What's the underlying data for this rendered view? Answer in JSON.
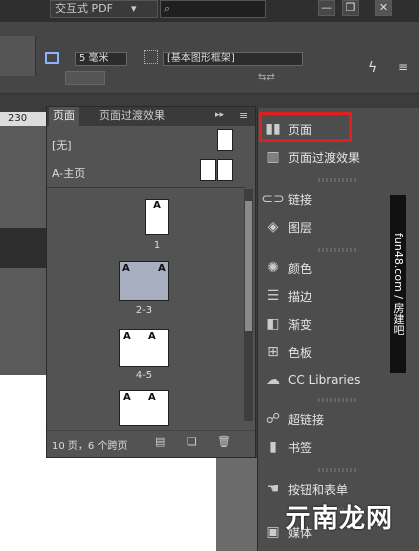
{
  "topbar": {
    "workspace": "交互式 PDF",
    "workspace_arrow": "▾",
    "search_icon": "⌕",
    "min": "—",
    "restore": "❐",
    "close": "✕"
  },
  "control": {
    "size_value": "5 毫米",
    "frame_style": "[基本图形框架]",
    "ruler_label": "230"
  },
  "pages_panel": {
    "tab_pages": "页面",
    "tab_transitions": "页面过渡效果",
    "master_none": "[无]",
    "master_a": "A-主页",
    "spreads": [
      {
        "label": "1",
        "pages": [
          "A"
        ]
      },
      {
        "label": "2-3",
        "pages": [
          "A",
          "A"
        ]
      },
      {
        "label": "4-5",
        "pages": [
          "A",
          "A"
        ]
      },
      {
        "label": "",
        "pages": [
          "A",
          "A"
        ]
      }
    ],
    "footer_text": "10 页，6 个跨页"
  },
  "dock": {
    "items": [
      {
        "label": "页面",
        "icon": "pages-icon"
      },
      {
        "label": "页面过渡效果",
        "icon": "page-transitions-icon"
      },
      {
        "label": "链接",
        "icon": "links-icon"
      },
      {
        "label": "图层",
        "icon": "layers-icon"
      },
      {
        "label": "颜色",
        "icon": "color-icon"
      },
      {
        "label": "描边",
        "icon": "stroke-icon"
      },
      {
        "label": "渐变",
        "icon": "gradient-icon"
      },
      {
        "label": "色板",
        "icon": "swatches-icon"
      },
      {
        "label": "CC Libraries",
        "icon": "cc-libraries-icon"
      },
      {
        "label": "超链接",
        "icon": "hyperlinks-icon"
      },
      {
        "label": "书签",
        "icon": "bookmarks-icon"
      },
      {
        "label": "按钮和表单",
        "icon": "buttons-forms-icon"
      },
      {
        "label": "媒体",
        "icon": "media-icon"
      }
    ]
  },
  "side_banner": "fun48.com / 房建吧",
  "watermark": "亓南龙网",
  "highlight_color": "#e02020"
}
